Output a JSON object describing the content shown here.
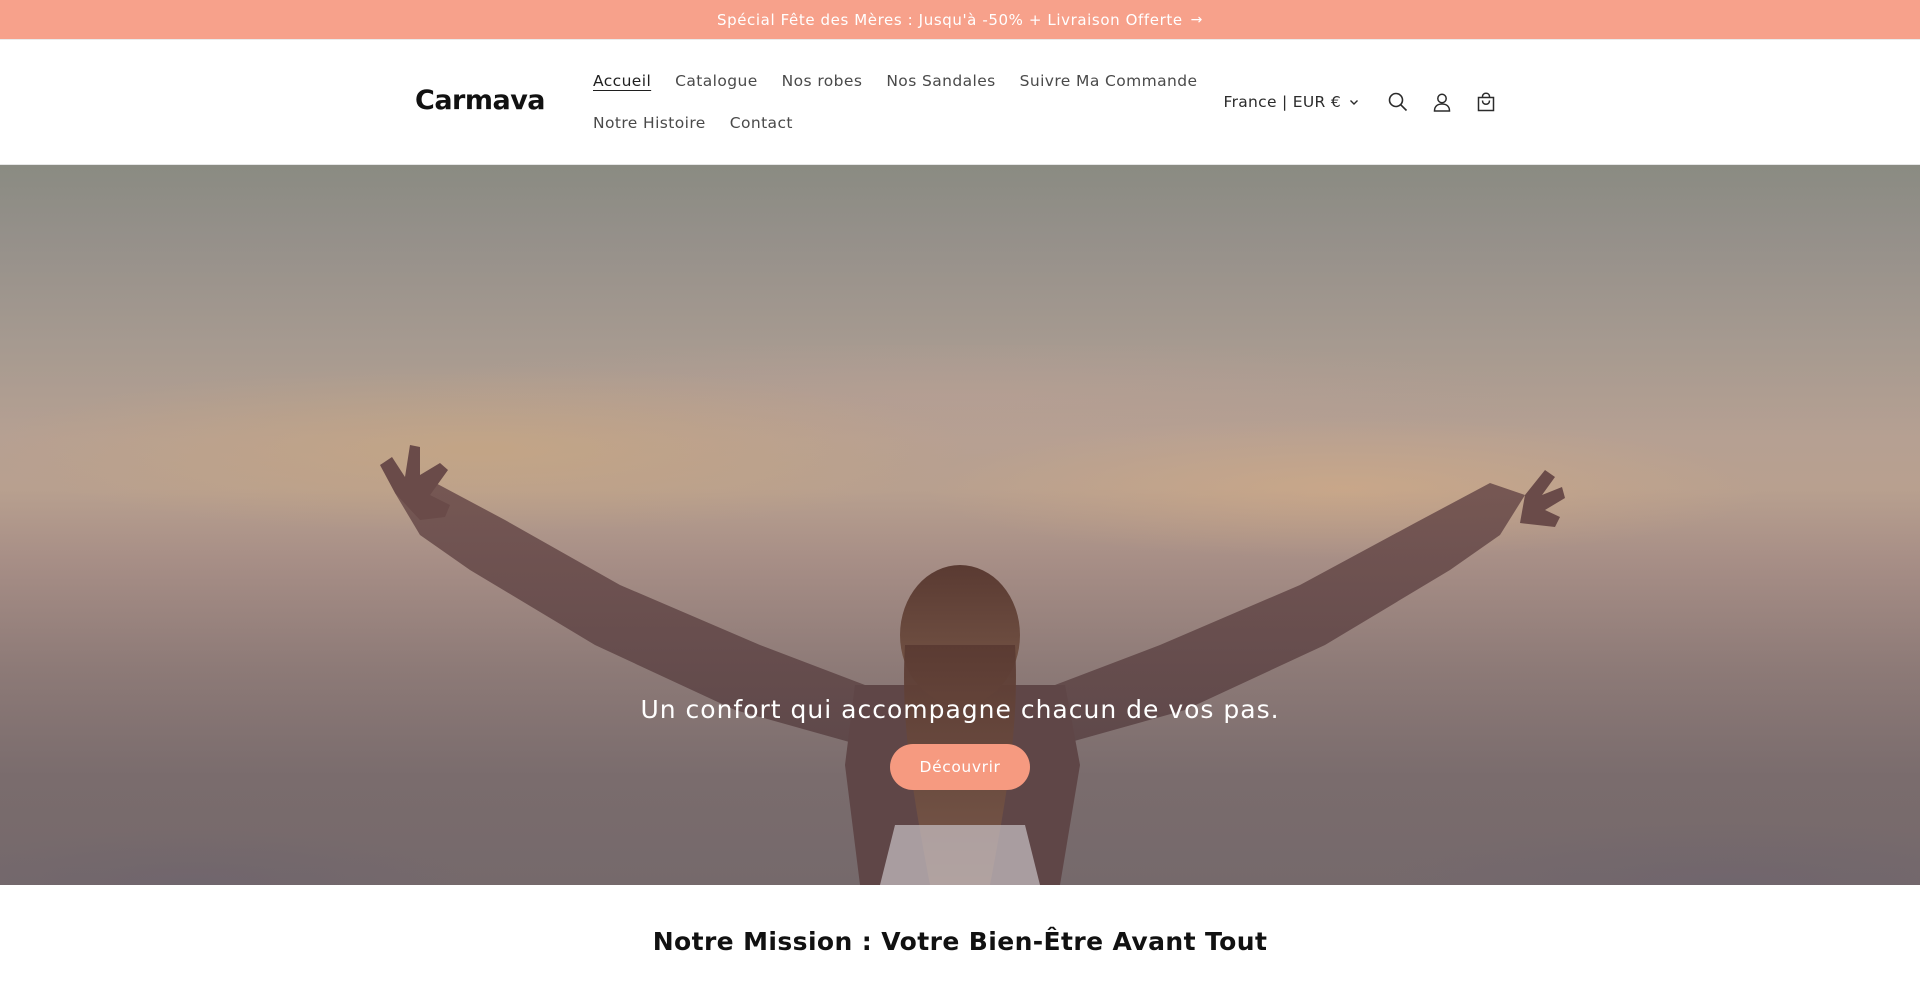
{
  "announcement": {
    "text": "Spécial Fête des Mères : Jusqu'à -50% + Livraison Offerte",
    "arrow": "→"
  },
  "header": {
    "logo": "Carmava",
    "nav": [
      {
        "label": "Accueil",
        "active": true
      },
      {
        "label": "Catalogue",
        "active": false
      },
      {
        "label": "Nos robes",
        "active": false
      },
      {
        "label": "Nos Sandales",
        "active": false
      },
      {
        "label": "Suivre Ma Commande",
        "active": false
      },
      {
        "label": "Notre Histoire",
        "active": false
      },
      {
        "label": "Contact",
        "active": false
      }
    ],
    "localization": "France | EUR €",
    "icons": [
      "search-icon",
      "account-icon",
      "cart-icon",
      "chevron-down-icon"
    ]
  },
  "hero": {
    "title": "Un confort qui accompagne chacun de vos pas.",
    "button": "Découvrir"
  },
  "mission": {
    "title": "Notre Mission : Votre Bien-Être Avant Tout"
  },
  "colors": {
    "announcement_bg": "#f7a18b",
    "button_bg": "#f69a80",
    "text_dark": "#111111"
  }
}
